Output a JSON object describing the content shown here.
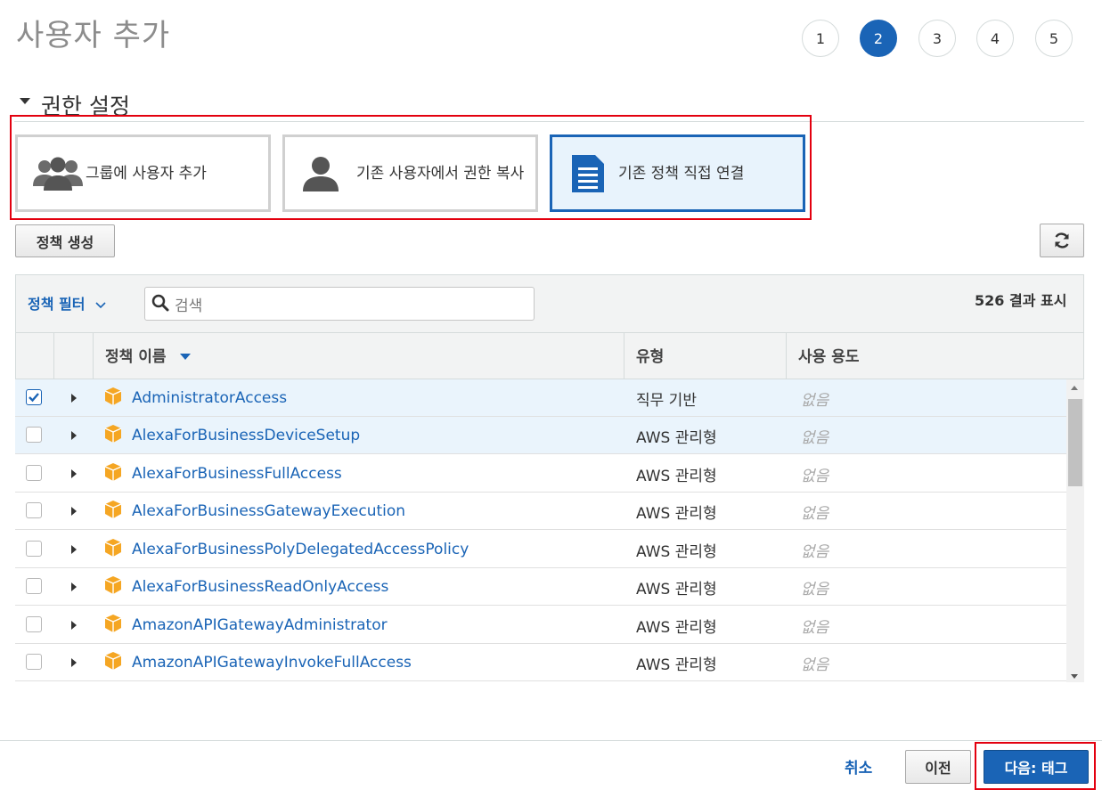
{
  "header": {
    "title": "사용자 추가",
    "steps": [
      "1",
      "2",
      "3",
      "4",
      "5"
    ],
    "active_step": "2"
  },
  "section": {
    "title": "권한 설정"
  },
  "options": [
    {
      "label": "그룹에 사용자 추가",
      "icon": "users-group-icon",
      "active": false
    },
    {
      "label": "기존 사용자에서 권한 복사",
      "icon": "user-icon",
      "active": false
    },
    {
      "label": "기존 정책 직접 연결",
      "icon": "document-icon",
      "active": true
    }
  ],
  "toolbar": {
    "create_policy_label": "정책 생성",
    "refresh_icon": "refresh-icon"
  },
  "table": {
    "filter_label": "정책 필터",
    "search_placeholder": "검색",
    "result_count": "526 결과 표시",
    "columns": {
      "name": "정책 이름",
      "type": "유형",
      "usage": "사용 용도"
    },
    "rows": [
      {
        "name": "AdministratorAccess",
        "type": "직무 기반",
        "usage": "없음",
        "checked": true
      },
      {
        "name": "AlexaForBusinessDeviceSetup",
        "type": "AWS 관리형",
        "usage": "없음",
        "checked": false
      },
      {
        "name": "AlexaForBusinessFullAccess",
        "type": "AWS 관리형",
        "usage": "없음",
        "checked": false
      },
      {
        "name": "AlexaForBusinessGatewayExecution",
        "type": "AWS 관리형",
        "usage": "없음",
        "checked": false
      },
      {
        "name": "AlexaForBusinessPolyDelegatedAccessPolicy",
        "type": "AWS 관리형",
        "usage": "없음",
        "checked": false
      },
      {
        "name": "AlexaForBusinessReadOnlyAccess",
        "type": "AWS 관리형",
        "usage": "없음",
        "checked": false
      },
      {
        "name": "AmazonAPIGatewayAdministrator",
        "type": "AWS 관리형",
        "usage": "없음",
        "checked": false
      },
      {
        "name": "AmazonAPIGatewayInvokeFullAccess",
        "type": "AWS 관리형",
        "usage": "없음",
        "checked": false
      }
    ]
  },
  "footer": {
    "cancel_label": "취소",
    "previous_label": "이전",
    "next_label": "다음: 태그"
  },
  "colors": {
    "accent": "#1a64b6",
    "highlight_frame": "#e3000f",
    "policy_icon": "#f5a623"
  }
}
